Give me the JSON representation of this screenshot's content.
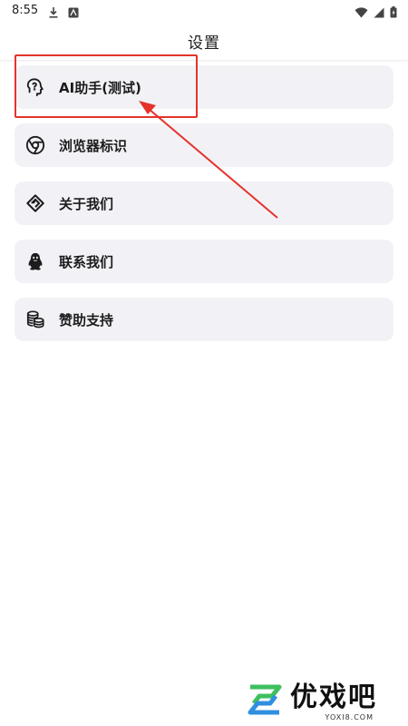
{
  "status_bar": {
    "time": "8:55",
    "icons_left": [
      "download-icon",
      "app-notification-icon"
    ],
    "icons_right": [
      "wifi-icon",
      "signal-icon",
      "battery-charging-icon"
    ]
  },
  "header": {
    "title": "设置"
  },
  "menu": {
    "items": [
      {
        "label": "AI助手(测试)",
        "icon": "ai-head-icon"
      },
      {
        "label": "浏览器标识",
        "icon": "chrome-icon"
      },
      {
        "label": "关于我们",
        "icon": "diamond-logo-icon"
      },
      {
        "label": "联系我们",
        "icon": "qq-penguin-icon"
      },
      {
        "label": "赞助支持",
        "icon": "coins-icon"
      }
    ]
  },
  "annotation": {
    "color": "#e5332a",
    "highlighted_item": "AI助手(测试)"
  },
  "watermark": {
    "brand": "优戏吧",
    "domain": "YOXI8.COM",
    "accent_green": "#3fbf5f",
    "accent_blue": "#2f8fe0"
  }
}
